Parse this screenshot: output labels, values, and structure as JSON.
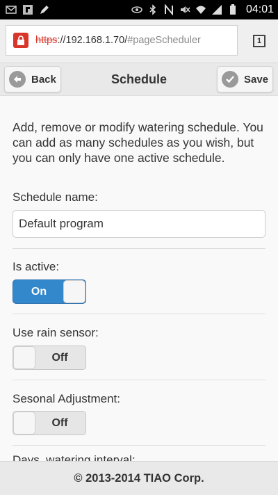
{
  "status_bar": {
    "left_icons": [
      "mail-icon",
      "flipboard-icon",
      "pen-icon"
    ],
    "right_icons": [
      "eye-icon",
      "bluetooth-icon",
      "nfc-icon",
      "mute-icon",
      "wifi-icon",
      "signal-icon",
      "battery-icon"
    ],
    "time": "04:01"
  },
  "browser": {
    "url_scheme": "https",
    "url_host": "://192.168.1.70/",
    "url_path": "#pageScheduler",
    "tab_count": "1"
  },
  "header": {
    "back_label": "Back",
    "title": "Schedule",
    "save_label": "Save"
  },
  "main": {
    "intro": "Add, remove or modify watering schedule. You can add as many schedules as you wish, but you can only have one active schedule.",
    "schedule_name_label": "Schedule name:",
    "schedule_name_value": "Default program",
    "is_active_label": "Is active:",
    "is_active_state": "On",
    "rain_sensor_label": "Use rain sensor:",
    "rain_sensor_state": "Off",
    "seasonal_label": "Sesonal Adjustment:",
    "seasonal_state": "Off",
    "next_label_partial": "Days, watering interval:"
  },
  "footer": {
    "copyright": "© 2013-2014 TIAO Corp."
  }
}
